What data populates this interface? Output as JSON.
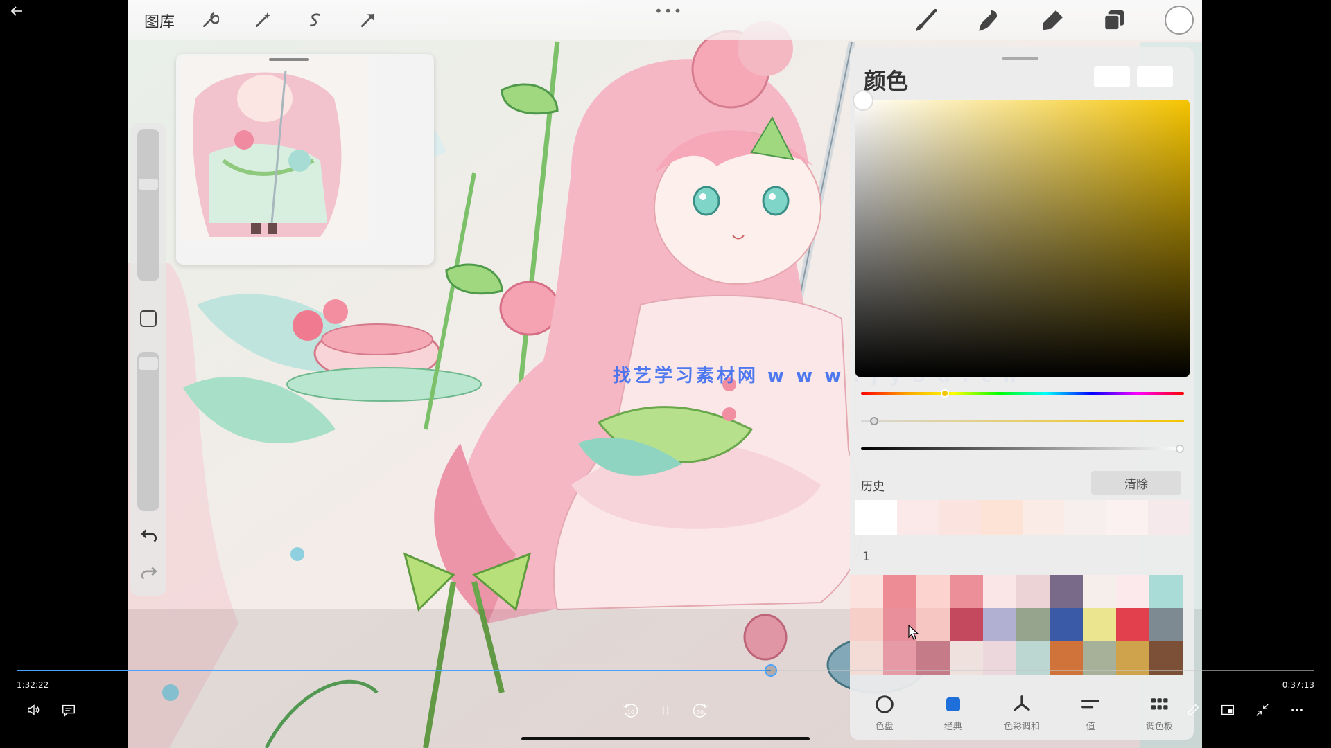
{
  "app": {
    "gallery_label": "图库",
    "toolbar_icons": [
      "wrench-icon",
      "magic-wand-icon",
      "selection-s-icon",
      "transform-arrow-icon"
    ],
    "right_tools": [
      "brush-icon",
      "smudge-icon",
      "eraser-icon",
      "layers-icon",
      "color-circle-icon"
    ],
    "more_icon": "•••"
  },
  "watermark": "找艺学习素材网  w w w . j y 3 d . c n",
  "color_panel": {
    "title": "颜色",
    "history_label": "历史",
    "clear_label": "清除",
    "palette_label": "1",
    "selected_color": "#ffffff",
    "hue_position": 0.26,
    "saturation_position": 0.04,
    "brightness_position": 1.0,
    "history": [
      "#ffffff",
      "#fbe9e9",
      "#fbe3e0",
      "#fde3d6",
      "#fbebe7",
      "#f7eeee",
      "#fbf1f1",
      "#f6e9ec"
    ],
    "palette": [
      "#fbe2de",
      "#ee8c96",
      "#fcd3cf",
      "#ec8f99",
      "#fae6e6",
      "#ecd3d6",
      "#7a6a8a",
      "#f6eeea",
      "#fbe9ec",
      "#a9dcd6",
      "#f6cfc9",
      "#e98f9b",
      "#f6c6c2",
      "#c4485e",
      "#b2b0d2",
      "#96a48e",
      "#3a5aa8",
      "#ece590",
      "#e1404c",
      "#7e8a92",
      "#f3dcd6",
      "#e69aa5",
      "#c67c88",
      "#efe1de",
      "#ecd8dc",
      "#bcd6d2",
      "#d0733a",
      "#a7b098",
      "#cfa24c",
      "#7c5036"
    ],
    "tabs": [
      {
        "label": "色盘",
        "icon": "disc-icon"
      },
      {
        "label": "经典",
        "icon": "classic-square-icon"
      },
      {
        "label": "色彩调和",
        "icon": "harmony-icon"
      },
      {
        "label": "值",
        "icon": "value-sliders-icon"
      },
      {
        "label": "调色板",
        "icon": "palette-grid-icon"
      }
    ]
  },
  "player": {
    "elapsed": "1:32:22",
    "remaining": "0:37:13",
    "progress": 0.581,
    "skip_back": "10",
    "skip_forward": "30"
  },
  "colors": {
    "accent": "#4aa3ff",
    "watermark": "#3b6df0"
  }
}
